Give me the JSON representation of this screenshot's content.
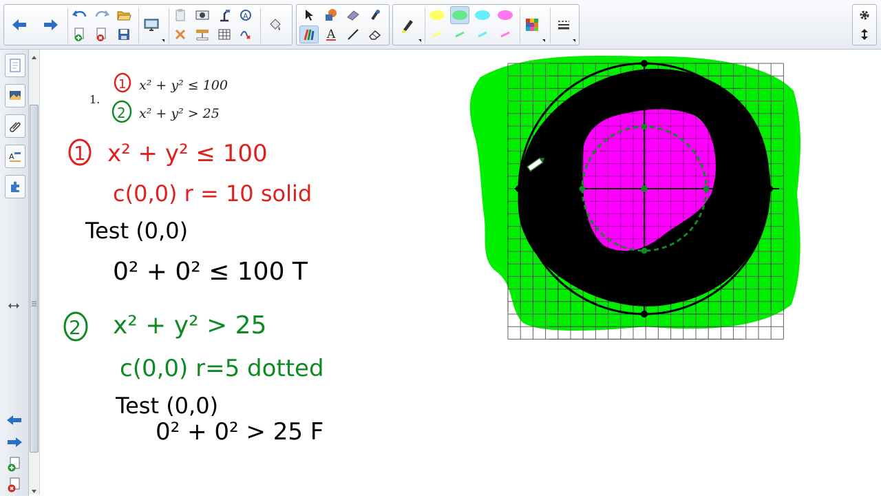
{
  "toolbar": {
    "groups": [
      "navigation",
      "page",
      "tools",
      "pens",
      "properties"
    ],
    "buttons": [
      {
        "name": "back-icon"
      },
      {
        "name": "forward-icon"
      },
      {
        "name": "undo-icon"
      },
      {
        "name": "redo-icon"
      },
      {
        "name": "open-folder-icon"
      },
      {
        "name": "add-page-icon"
      },
      {
        "name": "delete-page-icon"
      },
      {
        "name": "save-icon"
      },
      {
        "name": "display-icon"
      },
      {
        "name": "paste-icon"
      },
      {
        "name": "screen-capture-icon"
      },
      {
        "name": "document-camera-icon"
      },
      {
        "name": "shape-recognition-icon"
      },
      {
        "name": "delete-icon"
      },
      {
        "name": "screen-shade-icon"
      },
      {
        "name": "table-icon"
      },
      {
        "name": "spell-check-icon"
      },
      {
        "name": "fill-icon"
      },
      {
        "name": "select-icon"
      },
      {
        "name": "shapes-icon"
      },
      {
        "name": "eraser-icon"
      },
      {
        "name": "magic-pen-icon"
      },
      {
        "name": "creative-pens-icon"
      },
      {
        "name": "text-icon"
      },
      {
        "name": "line-icon"
      },
      {
        "name": "eraser-tool-icon"
      },
      {
        "name": "highlighter-icon"
      },
      {
        "name": "properties-palette-icon"
      },
      {
        "name": "move-toolbar-icon"
      }
    ],
    "highlighter_colors": [
      "#ffff66",
      "#66e88a",
      "#66eeff",
      "#ff77ee"
    ],
    "selected_highlighter_color": "#66e88a",
    "settings_icon": "gear-icon",
    "move_icon": "up-down-arrow-icon"
  },
  "sidebar": {
    "tabs": [
      "page-sorter-icon",
      "gallery-icon",
      "attachments-icon",
      "properties-icon",
      "add-ons-icon"
    ],
    "bottom": [
      "previous-page-icon",
      "next-page-icon",
      "add-page-icon",
      "delete-page-icon"
    ],
    "resize_icon": "resize-arrows-icon"
  },
  "problem": {
    "number": "1.",
    "ineq1_label": "1",
    "ineq1": "x² + y² ≤ 100",
    "ineq2_label": "2",
    "ineq2": "x² + y² > 25"
  },
  "work": {
    "red_label": "1",
    "red_eq": "x² + y² ≤ 100",
    "red_center": "c(0,0)  r = 10   solid",
    "test1": "Test (0,0)",
    "test1_eval": "0² + 0² ≤ 100  T",
    "green_label": "2",
    "green_eq": "x² + y² > 25",
    "green_center": "c(0,0)   r=5  dotted",
    "test2": "Test  (0,0)",
    "test2_eval": "0² + 0² > 25  F"
  },
  "colors": {
    "red": "#e0201e",
    "green": "#0f8a23",
    "black": "#000000",
    "highlight_green": "#00ee00",
    "magenta": "#ff00ff"
  }
}
